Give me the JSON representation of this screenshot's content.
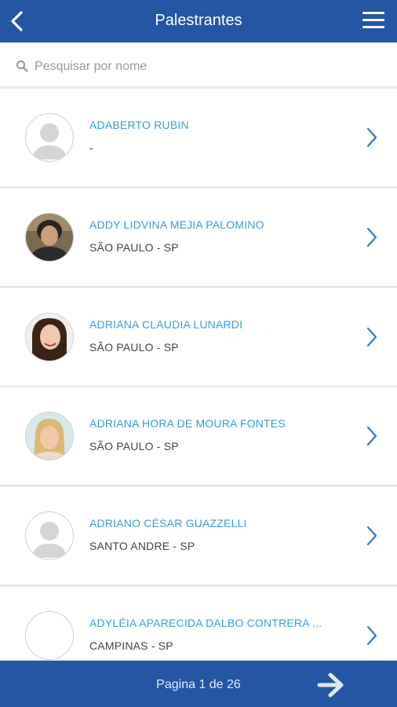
{
  "header": {
    "title": "Palestrantes",
    "back_icon": "chevron-left-icon",
    "menu_icon": "hamburger-menu-icon"
  },
  "search": {
    "placeholder": "Pesquisar por nome",
    "value": ""
  },
  "speakers": [
    {
      "name": "ADABERTO RUBIN",
      "city": "-",
      "avatar": "placeholder"
    },
    {
      "name": "ADDY LIDVINA MEJIA PALOMINO",
      "city": "SÃO PAULO - SP",
      "avatar": "photo"
    },
    {
      "name": "ADRIANA CLAUDIA LUNARDI",
      "city": "SÃO PAULO - SP",
      "avatar": "photo"
    },
    {
      "name": "ADRIANA HORA DE MOURA FONTES",
      "city": "SÃO PAULO - SP",
      "avatar": "photo"
    },
    {
      "name": "ADRIANO CÉSAR GUAZZELLI",
      "city": "SANTO ANDRE - SP",
      "avatar": "placeholder"
    },
    {
      "name": "ADYLÉIA APARECIDA DALBO CONTRERA ...",
      "city": "CAMPINAS - SP",
      "avatar": "blank"
    }
  ],
  "pagination": {
    "label": "Pagina 1 de 26",
    "next_icon": "arrow-right-icon"
  },
  "colors": {
    "header_bg": "#2456a4",
    "name_text": "#3b9bd8",
    "chevron": "#2e7bd6"
  }
}
